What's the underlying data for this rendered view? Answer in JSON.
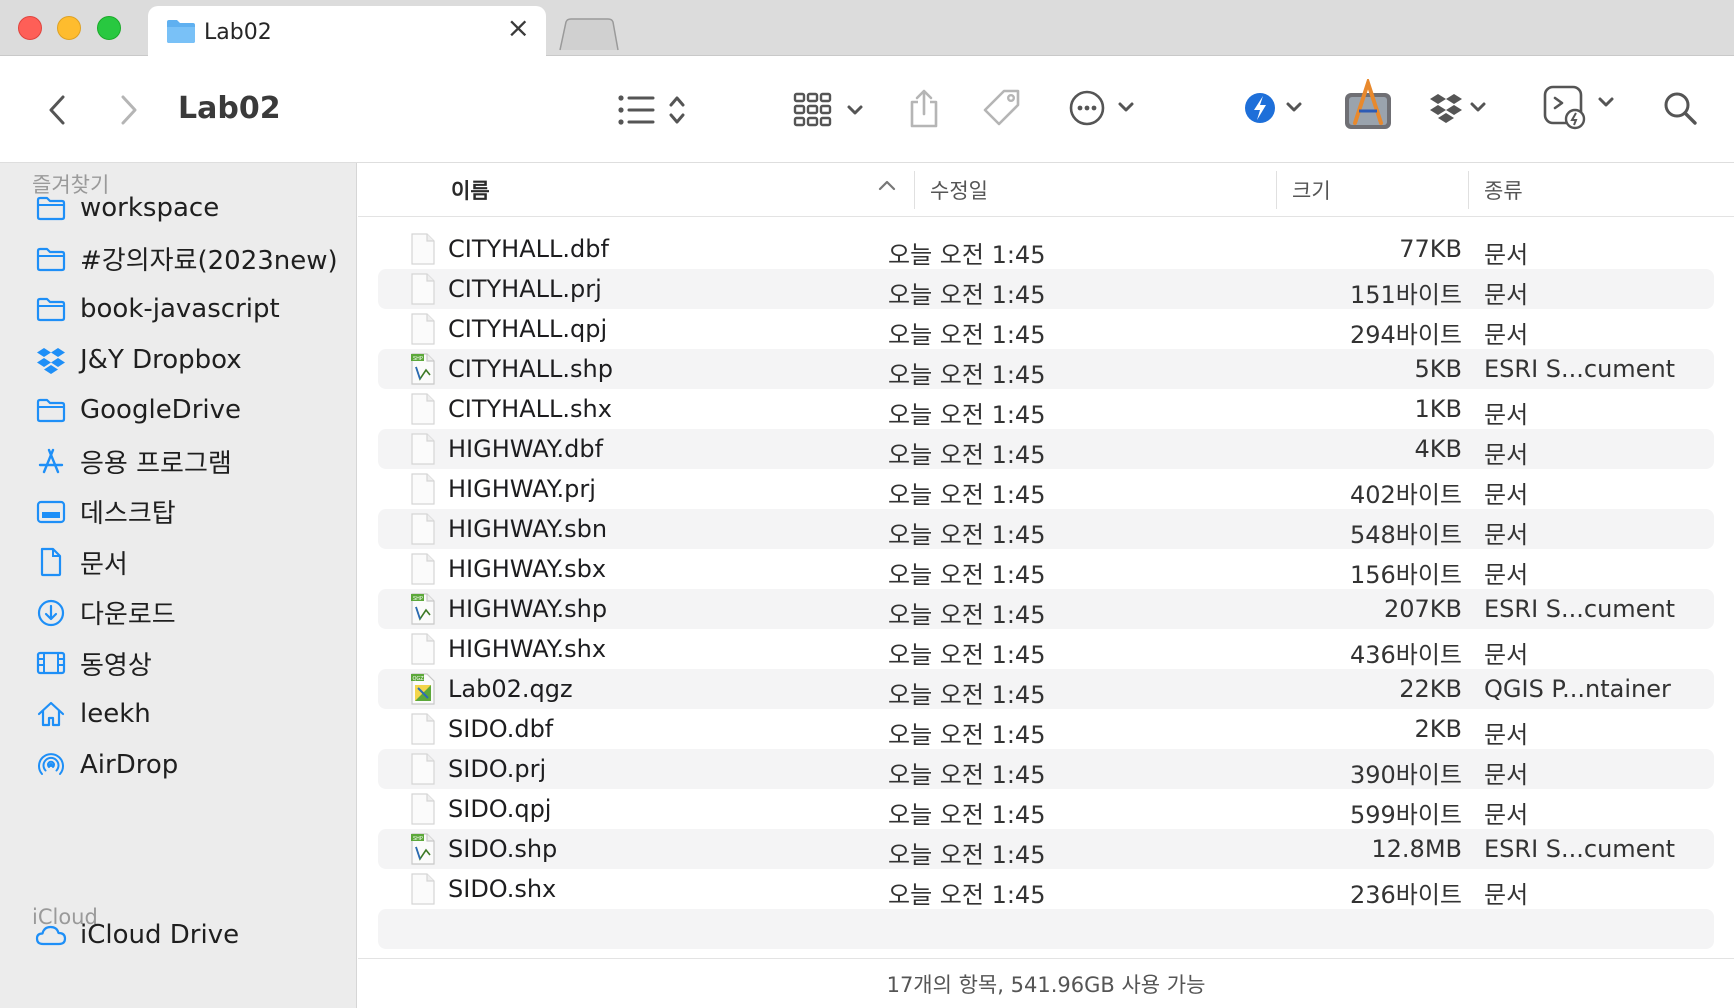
{
  "tab": {
    "title": "Lab02"
  },
  "toolbar": {
    "title": "Lab02"
  },
  "sidebar": {
    "favorites_label": "즐겨찾기",
    "favorites": [
      {
        "label": "workspace",
        "icon": "folder-icon"
      },
      {
        "label": "#강의자료(2023new)",
        "icon": "folder-icon"
      },
      {
        "label": "book-javascript",
        "icon": "folder-icon"
      },
      {
        "label": "J&Y Dropbox",
        "icon": "dropbox-icon"
      },
      {
        "label": "GoogleDrive",
        "icon": "folder-icon"
      },
      {
        "label": "응용 프로그램",
        "icon": "applications-icon"
      },
      {
        "label": "데스크탑",
        "icon": "desktop-icon"
      },
      {
        "label": "문서",
        "icon": "document-icon"
      },
      {
        "label": "다운로드",
        "icon": "download-icon"
      },
      {
        "label": "동영상",
        "icon": "movie-icon"
      },
      {
        "label": "leekh",
        "icon": "home-icon"
      },
      {
        "label": "AirDrop",
        "icon": "airdrop-icon"
      }
    ],
    "icloud_label": "iCloud",
    "icloud": [
      {
        "label": "iCloud Drive",
        "icon": "cloud-icon"
      }
    ]
  },
  "columns": {
    "name": "이름",
    "date": "수정일",
    "size": "크기",
    "kind": "종류"
  },
  "files": [
    {
      "name": "CITYHALL.dbf",
      "date": "오늘 오전 1:45",
      "size": "77KB",
      "kind": "문서",
      "icon": "document-icon"
    },
    {
      "name": "CITYHALL.prj",
      "date": "오늘 오전 1:45",
      "size": "151바이트",
      "kind": "문서",
      "icon": "document-icon"
    },
    {
      "name": "CITYHALL.qpj",
      "date": "오늘 오전 1:45",
      "size": "294바이트",
      "kind": "문서",
      "icon": "document-icon"
    },
    {
      "name": "CITYHALL.shp",
      "date": "오늘 오전 1:45",
      "size": "5KB",
      "kind": "ESRI S...cument",
      "icon": "shapefile-icon"
    },
    {
      "name": "CITYHALL.shx",
      "date": "오늘 오전 1:45",
      "size": "1KB",
      "kind": "문서",
      "icon": "document-icon"
    },
    {
      "name": "HIGHWAY.dbf",
      "date": "오늘 오전 1:45",
      "size": "4KB",
      "kind": "문서",
      "icon": "document-icon"
    },
    {
      "name": "HIGHWAY.prj",
      "date": "오늘 오전 1:45",
      "size": "402바이트",
      "kind": "문서",
      "icon": "document-icon"
    },
    {
      "name": "HIGHWAY.sbn",
      "date": "오늘 오전 1:45",
      "size": "548바이트",
      "kind": "문서",
      "icon": "document-icon"
    },
    {
      "name": "HIGHWAY.sbx",
      "date": "오늘 오전 1:45",
      "size": "156바이트",
      "kind": "문서",
      "icon": "document-icon"
    },
    {
      "name": "HIGHWAY.shp",
      "date": "오늘 오전 1:45",
      "size": "207KB",
      "kind": "ESRI S...cument",
      "icon": "shapefile-icon"
    },
    {
      "name": "HIGHWAY.shx",
      "date": "오늘 오전 1:45",
      "size": "436바이트",
      "kind": "문서",
      "icon": "document-icon"
    },
    {
      "name": "Lab02.qgz",
      "date": "오늘 오전 1:45",
      "size": "22KB",
      "kind": "QGIS P...ntainer",
      "icon": "qgis-project-icon"
    },
    {
      "name": "SIDO.dbf",
      "date": "오늘 오전 1:45",
      "size": "2KB",
      "kind": "문서",
      "icon": "document-icon"
    },
    {
      "name": "SIDO.prj",
      "date": "오늘 오전 1:45",
      "size": "390바이트",
      "kind": "문서",
      "icon": "document-icon"
    },
    {
      "name": "SIDO.qpj",
      "date": "오늘 오전 1:45",
      "size": "599바이트",
      "kind": "문서",
      "icon": "document-icon"
    },
    {
      "name": "SIDO.shp",
      "date": "오늘 오전 1:45",
      "size": "12.8MB",
      "kind": "ESRI S...cument",
      "icon": "shapefile-icon"
    },
    {
      "name": "SIDO.shx",
      "date": "오늘 오전 1:45",
      "size": "236바이트",
      "kind": "문서",
      "icon": "document-icon"
    }
  ],
  "status": {
    "text": "17개의 항목, 541.96GB 사용 가능"
  },
  "colors": {
    "accent": "#1e8ff7",
    "sidebar_bg": "#ececec",
    "row_alt": "#f4f4f5"
  }
}
